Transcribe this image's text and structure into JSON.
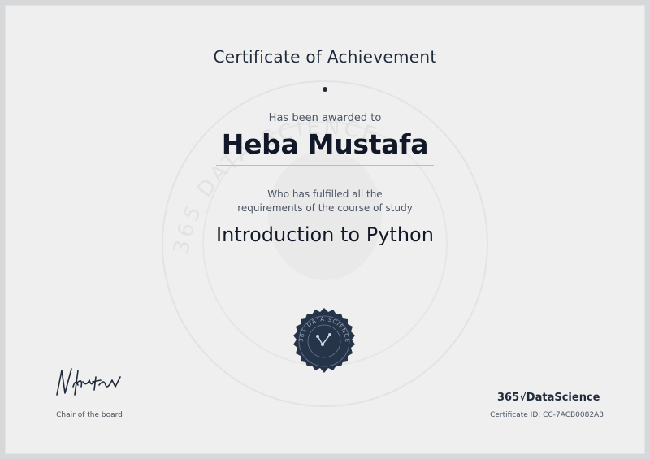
{
  "certificate": {
    "heading": "Certificate of Achievement",
    "awarded_to_label": "Has been awarded to",
    "recipient_name": "Heba Mustafa",
    "fulfilled_line_1": "Who has fulfilled all the",
    "fulfilled_line_2": "requirements of the course of study",
    "course_title": "Introduction to Python",
    "signatory_role": "Chair of the board",
    "signature_text": "N.Krastev",
    "brand_name": "365√DataScience",
    "certificate_id": "Certificate ID: CC-7ACB0082A3",
    "watermark_text": "365 DATA SCIENCE",
    "seal_text": "365 DATA SCIENCE"
  },
  "colors": {
    "border": "#d7d8d9",
    "paper": "#efefef",
    "ink": "#1f2a3a",
    "seal": "#26344a"
  }
}
